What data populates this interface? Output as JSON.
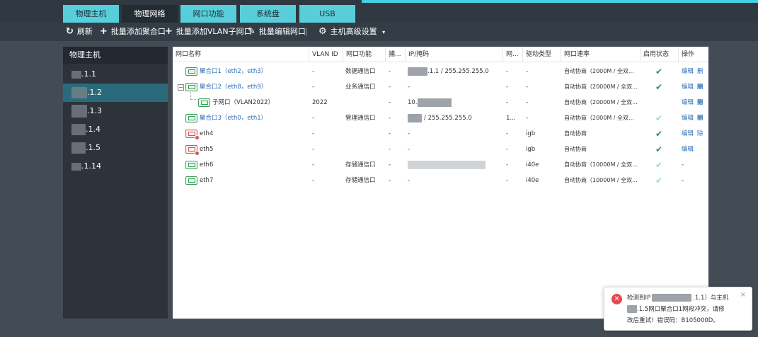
{
  "tabs": [
    {
      "label": "物理主机",
      "active": false
    },
    {
      "label": "物理网络",
      "active": true
    },
    {
      "label": "网口功能",
      "active": false
    },
    {
      "label": "系统盘",
      "active": false
    },
    {
      "label": "USB",
      "active": false
    }
  ],
  "toolbar": {
    "refresh": "刷新",
    "batch_add_bond": "批量添加聚合口",
    "batch_add_vlan": "批量添加VLAN子网口",
    "batch_edit": "批量编辑网口",
    "host_settings": "主机高级设置"
  },
  "sidebar": {
    "title": "物理主机",
    "items": [
      {
        "label": ".1.1",
        "selected": false
      },
      {
        "label": ".1.2",
        "selected": true
      },
      {
        "label": ".1.3",
        "selected": false
      },
      {
        "label": ".1.4",
        "selected": false
      },
      {
        "label": ".1.5",
        "selected": false
      },
      {
        "label": ".1.14",
        "selected": false
      }
    ]
  },
  "table": {
    "columns": [
      "网口名称",
      "VLAN ID",
      "网口功能",
      "捕...",
      "IP/掩码",
      "网...",
      "驱动类型",
      "网口速率",
      "启用状态",
      "操作"
    ],
    "rows": [
      {
        "name": "聚合口1（eth2，eth3）",
        "vlan": "-",
        "func": "数据通信口",
        "cap": "-",
        "ip": ".1.1 / 255.255.255.0",
        "net": "-",
        "driver": "-",
        "speed": "自动协商（2000M / 全双...",
        "enabled": true,
        "edit": "编辑",
        "delete": "删除"
      },
      {
        "name": "聚合口2（eth8，eth9）",
        "vlan": "-",
        "func": "业务通信口",
        "cap": "-",
        "ip": "-",
        "net": "-",
        "driver": "-",
        "speed": "自动协商（20000M / 全双...",
        "enabled": true,
        "edit": "编辑",
        "delete": "删除"
      },
      {
        "name": "子网口（VLAN2022）",
        "vlan": "2022",
        "func": "",
        "cap": "-",
        "ip": "10.",
        "net": "-",
        "driver": "-",
        "speed": "自动协商（20000M / 全双...",
        "enabled": false,
        "edit": "编辑",
        "delete": "删除"
      },
      {
        "name": "聚合口3（eth0，eth1）",
        "vlan": "-",
        "func": "管理通信口",
        "cap": "-",
        "ip": "/ 255.255.255.0",
        "net": "1...",
        "driver": "-",
        "speed": "自动协商（2000M / 全双...",
        "enabled": true,
        "edit": "编辑",
        "delete": "删除"
      },
      {
        "name": "eth4",
        "vlan": "-",
        "func": "",
        "cap": "-",
        "ip": "-",
        "net": "-",
        "driver": "igb",
        "speed": "自动协商",
        "enabled": true,
        "edit": "编辑",
        "delete": ""
      },
      {
        "name": "eth5",
        "vlan": "-",
        "func": "",
        "cap": "-",
        "ip": "-",
        "net": "-",
        "driver": "igb",
        "speed": "自动协商",
        "enabled": true,
        "edit": "编辑",
        "delete": ""
      },
      {
        "name": "eth6",
        "vlan": "-",
        "func": "存储通信口",
        "cap": "-",
        "ip": "",
        "net": "-",
        "driver": "i40e",
        "speed": "自动协商（10000M / 全双...",
        "enabled": true,
        "edit": "-",
        "delete": ""
      },
      {
        "name": "eth7",
        "vlan": "-",
        "func": "存储通信口",
        "cap": "-",
        "ip": "-",
        "net": "-",
        "driver": "i40e",
        "speed": "自动协商（10000M / 全双...",
        "enabled": true,
        "edit": "-",
        "delete": ""
      }
    ]
  },
  "toast": {
    "line1_a": "检测到IP",
    "line1_b": ".1.1）与主机",
    "line2": ".1.5网口聚合口1网段冲突，请修",
    "line3": "改后重试！错误码：B105000D。",
    "close": "×"
  },
  "colors": {
    "tab": "#59cedb",
    "tab_active": "#232b33",
    "accent": "#44d1e1",
    "link": "#2f6fb5",
    "check": "#2f8f5b",
    "error": "#e8474e",
    "selected": "#2b6a7a"
  }
}
